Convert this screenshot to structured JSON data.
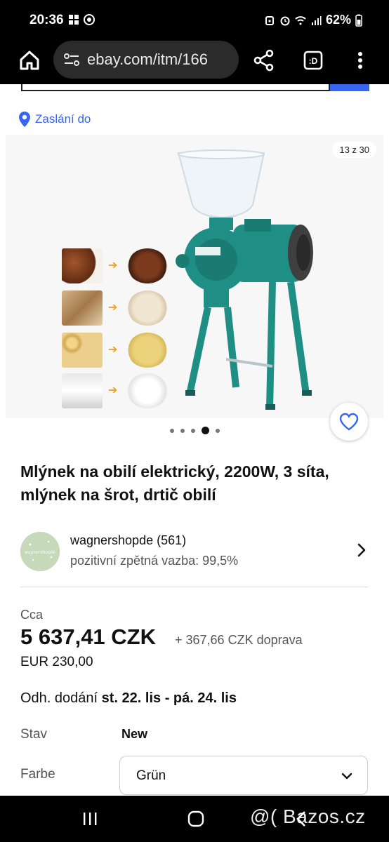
{
  "status_bar": {
    "time": "20:36",
    "battery": "62%"
  },
  "browser": {
    "url": "ebay.com/itm/166",
    "tab_icon_label": ":D"
  },
  "shipping_to": {
    "label": "Zaslání do"
  },
  "gallery": {
    "counter": "13 z 30",
    "current_index": 4,
    "dot_count": 5
  },
  "product": {
    "title": "Mlýnek na obilí elektrický, 2200W, 3 síta, mlýnek na šrot, drtič obilí"
  },
  "seller": {
    "name": "wagnershopde (561)",
    "feedback": "pozitivní zpětná vazba: 99,5%",
    "avatar_text": "wagnershopde"
  },
  "pricing": {
    "approx_label": "Cca",
    "price": "5 637,41 CZK",
    "shipping": "+ 367,66 CZK doprava",
    "eur": "EUR 230,00"
  },
  "delivery": {
    "prefix": "Odh. dodání",
    "range": "st. 22. lis - pá. 24. lis"
  },
  "specs": {
    "condition_label": "Stav",
    "condition_value": "New",
    "color_label": "Farbe",
    "color_value": "Grün"
  },
  "watermark": {
    "text": "@( Bazos.cz"
  },
  "colors": {
    "accent_blue": "#3665f3",
    "machine_green": "#1f8f86",
    "arrow_orange": "#f2a21b"
  }
}
